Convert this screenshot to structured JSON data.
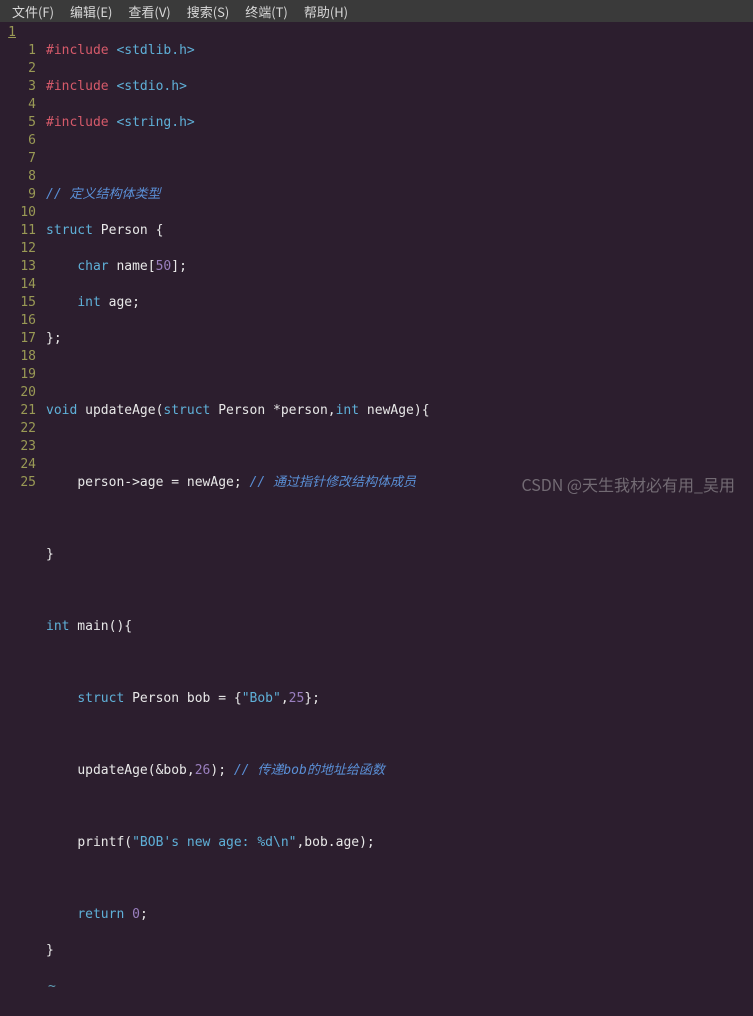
{
  "menu": {
    "file": "文件(F)",
    "edit": "编辑(E)",
    "view": "查看(V)",
    "search": "搜索(S)",
    "terminal": "终端(T)",
    "help": "帮助(H)"
  },
  "gutter_left": [
    "1",
    "",
    "",
    "",
    "",
    "",
    "",
    "",
    "",
    "",
    "",
    "",
    "",
    "",
    "",
    "",
    "",
    "",
    "",
    "",
    "",
    "",
    "",
    "",
    "",
    "",
    ""
  ],
  "gutter_right": [
    "",
    "1",
    "2",
    "3",
    "4",
    "5",
    "6",
    "7",
    "8",
    "9",
    "10",
    "11",
    "12",
    "13",
    "14",
    "15",
    "16",
    "17",
    "18",
    "19",
    "20",
    "21",
    "22",
    "23",
    "24",
    "25",
    ""
  ],
  "code": {
    "l0_kw": "#include",
    "l0_h": " <stdlib.h>",
    "l1_kw": "#include",
    "l1_h": " <stdio.h>",
    "l2_kw": "#include",
    "l2_h": " <string.h>",
    "l3": "",
    "l4_cmt": "// 定义结构体类型",
    "l5_kw": "struct",
    "l5_rest": " Person {",
    "l6_sp": "    ",
    "l6_kw": "char",
    "l6_rest1": " name[",
    "l6_num": "50",
    "l6_rest2": "];",
    "l7_sp": "    ",
    "l7_kw": "int",
    "l7_rest": " age;",
    "l8": "};",
    "l9": "",
    "l10_kw1": "void",
    "l10_t1": " updateAge(",
    "l10_kw2": "struct",
    "l10_t2": " Person *person,",
    "l10_kw3": "int",
    "l10_t3": " newAge){",
    "l11": "",
    "l12_sp": "    ",
    "l12_code": "person->age = newAge; ",
    "l12_cmt": "// 通过指针修改结构体成员",
    "l13": "",
    "l14": "}",
    "l15": "",
    "l16_kw": "int",
    "l16_rest": " main(){",
    "l17": "",
    "l18_sp": "    ",
    "l18_kw": "struct",
    "l18_t1": " Person bob = {",
    "l18_str": "\"Bob\"",
    "l18_t2": ",",
    "l18_num": "25",
    "l18_t3": "};",
    "l19": "",
    "l20_sp": "    ",
    "l20_t1": "updateAge(&bob,",
    "l20_num": "26",
    "l20_t2": "); ",
    "l20_cmt": "// 传递bob的地址给函数",
    "l21": "",
    "l22_sp": "    ",
    "l22_t1": "printf(",
    "l22_str": "\"BOB's new age: %d\\n\"",
    "l22_t2": ",bob.age);",
    "l23": "",
    "l24_sp": "    ",
    "l24_kw": "return",
    "l24_sp2": " ",
    "l24_num": "0",
    "l24_t": ";",
    "l25": "}",
    "tilde": "~"
  },
  "watermark": "CSDN @天生我材必有用_吴用"
}
